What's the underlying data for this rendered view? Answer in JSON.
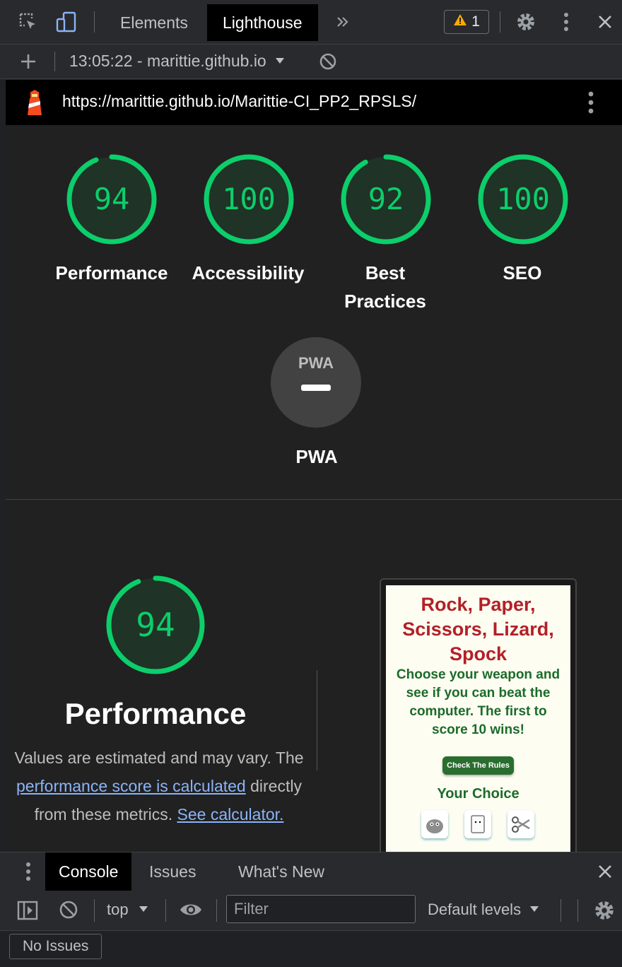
{
  "devtools": {
    "tabs": [
      {
        "label": "Elements",
        "active": false
      },
      {
        "label": "Lighthouse",
        "active": true
      }
    ],
    "more_tabs_icon": "chevrons-right-icon",
    "warning_count": "1",
    "icons": [
      "inspect-element-icon",
      "device-toolbar-icon",
      "warning-icon",
      "gear-icon",
      "kebab-menu-icon",
      "close-icon"
    ]
  },
  "report_bar": {
    "report_select": "13:05:22 - marittie.github.io"
  },
  "url_bar": {
    "url": "https://marittie.github.io/Marittie-CI_PP2_RPSLS/"
  },
  "scores": [
    {
      "score": "94",
      "label": "Performance",
      "value": 94
    },
    {
      "score": "100",
      "label": "Accessibility",
      "value": 100
    },
    {
      "score": "92",
      "label": "Best Practices",
      "value": 92
    },
    {
      "score": "100",
      "label": "SEO",
      "value": 100
    }
  ],
  "pwa": {
    "badge": "PWA",
    "label": "PWA"
  },
  "performance_section": {
    "score": "94",
    "value": 94,
    "title": "Performance",
    "desc_prefix": "Values are estimated and may vary. The ",
    "desc_link": "performance score is calculated",
    "desc_mid": " directly from these metrics. ",
    "desc_link2": "See calculator."
  },
  "thumbnail": {
    "title": "Rock, Paper, Scissors, Lizard, Spock",
    "subtitle": "Choose your weapon and see if you can beat the computer. The first to score 10 wins!",
    "button": "Check The Rules",
    "choice_heading": "Your Choice",
    "weapons": [
      "rock-icon",
      "paper-icon",
      "scissors-icon"
    ]
  },
  "drawer": {
    "tabs": [
      {
        "label": "Console",
        "active": true
      },
      {
        "label": "Issues",
        "active": false
      },
      {
        "label": "What's New",
        "active": false
      }
    ],
    "context": "top",
    "filter_placeholder": "Filter",
    "levels": "Default levels",
    "no_issues": "No Issues"
  },
  "colors": {
    "pass": "#0cce6b",
    "pass_text": "#0cce6b",
    "gauge_bg": "#1f3326",
    "pwa_bg": "#424242",
    "link": "#8ab4f8"
  }
}
